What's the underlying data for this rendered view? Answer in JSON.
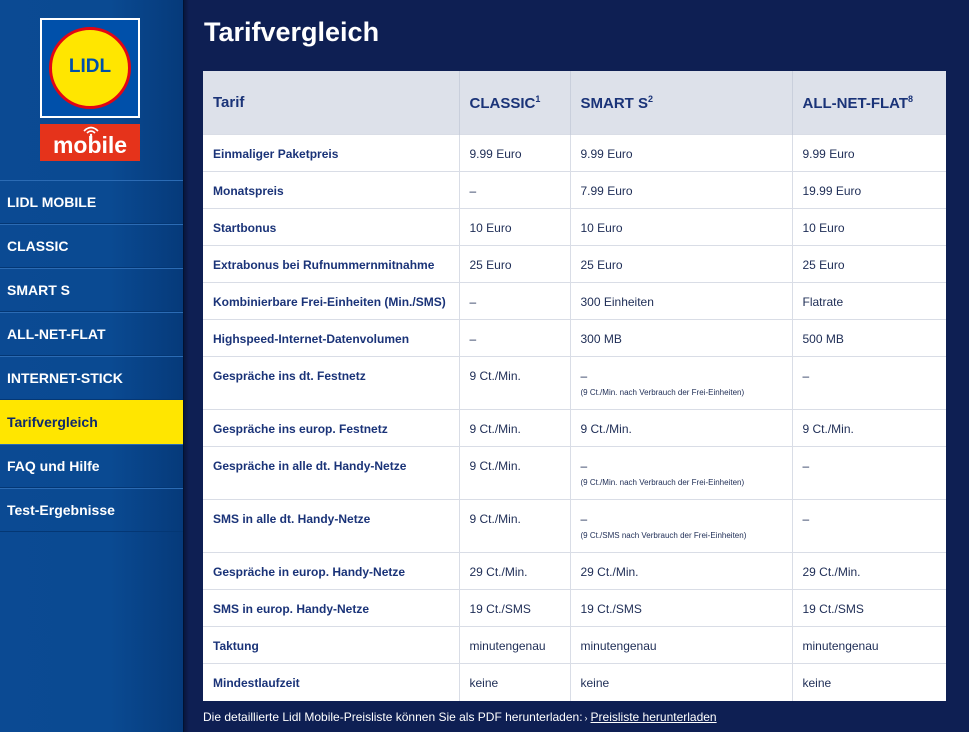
{
  "brand": {
    "logo_text": "LIDL",
    "sub": "mobile"
  },
  "nav": [
    {
      "label": "LIDL MOBILE"
    },
    {
      "label": "CLASSIC"
    },
    {
      "label": "SMART S"
    },
    {
      "label": "ALL-NET-FLAT"
    },
    {
      "label": "INTERNET-STICK"
    },
    {
      "label": "Tarifvergleich",
      "active": true
    },
    {
      "label": "FAQ und Hilfe"
    },
    {
      "label": "Test-Ergebnisse"
    }
  ],
  "page": {
    "title": "Tarifvergleich"
  },
  "table": {
    "headers": [
      {
        "label": "Tarif",
        "sup": ""
      },
      {
        "label": "CLASSIC",
        "sup": "1"
      },
      {
        "label": "SMART S",
        "sup": "2"
      },
      {
        "label": "ALL-NET-FLAT",
        "sup": "8"
      }
    ],
    "rows": [
      {
        "label": "Einmaliger Paketpreis",
        "cells": [
          {
            "v": "9.99 Euro"
          },
          {
            "v": "9.99 Euro"
          },
          {
            "v": "9.99 Euro"
          }
        ]
      },
      {
        "label": "Monatspreis",
        "cells": [
          {
            "v": "–"
          },
          {
            "v": "7.99 Euro"
          },
          {
            "v": "19.99 Euro"
          }
        ]
      },
      {
        "label": "Startbonus",
        "cells": [
          {
            "v": "10 Euro"
          },
          {
            "v": "10 Euro"
          },
          {
            "v": "10 Euro"
          }
        ]
      },
      {
        "label": "Extrabonus bei Rufnummernmitnahme",
        "cells": [
          {
            "v": "25 Euro"
          },
          {
            "v": "25 Euro"
          },
          {
            "v": "25 Euro"
          }
        ]
      },
      {
        "label": "Kombinierbare Frei-Einheiten (Min./SMS)",
        "cells": [
          {
            "v": "–"
          },
          {
            "v": "300 Einheiten"
          },
          {
            "v": "Flatrate"
          }
        ]
      },
      {
        "label": "Highspeed-Internet-Datenvolumen",
        "cells": [
          {
            "v": "–"
          },
          {
            "v": "300 MB"
          },
          {
            "v": "500 MB"
          }
        ]
      },
      {
        "label": "Gespräche ins dt. Festnetz",
        "tall": true,
        "cells": [
          {
            "v": "9 Ct./Min."
          },
          {
            "v": "–",
            "note": "(9 Ct./Min. nach Verbrauch der Frei-Einheiten)"
          },
          {
            "v": "–"
          }
        ]
      },
      {
        "label": "Gespräche ins europ. Festnetz",
        "cells": [
          {
            "v": "9 Ct./Min."
          },
          {
            "v": "9 Ct./Min."
          },
          {
            "v": "9 Ct./Min."
          }
        ]
      },
      {
        "label": "Gespräche in alle dt. Handy-Netze",
        "tall": true,
        "cells": [
          {
            "v": "9 Ct./Min."
          },
          {
            "v": "–",
            "note": "(9 Ct./Min. nach Verbrauch der Frei-Einheiten)"
          },
          {
            "v": "–"
          }
        ]
      },
      {
        "label": "SMS in alle dt. Handy-Netze",
        "tall": true,
        "cells": [
          {
            "v": "9 Ct./Min."
          },
          {
            "v": "–",
            "note": "(9 Ct./SMS nach Verbrauch der Frei-Einheiten)"
          },
          {
            "v": "–"
          }
        ]
      },
      {
        "label": "Gespräche in europ. Handy-Netze",
        "cells": [
          {
            "v": "29 Ct./Min."
          },
          {
            "v": "29 Ct./Min."
          },
          {
            "v": "29 Ct./Min."
          }
        ]
      },
      {
        "label": "SMS in europ. Handy-Netze",
        "cells": [
          {
            "v": "19 Ct./SMS"
          },
          {
            "v": "19 Ct./SMS"
          },
          {
            "v": "19 Ct./SMS"
          }
        ]
      },
      {
        "label": "Taktung",
        "cells": [
          {
            "v": "minutengenau"
          },
          {
            "v": "minutengenau"
          },
          {
            "v": "minutengenau"
          }
        ]
      },
      {
        "label": "Mindestlaufzeit",
        "cells": [
          {
            "v": "keine"
          },
          {
            "v": "keine"
          },
          {
            "v": "keine"
          }
        ]
      }
    ]
  },
  "footer": {
    "text": "Die detaillierte Lidl Mobile-Preisliste können Sie als PDF herunterladen:",
    "link": "Preisliste herunterladen"
  },
  "colors": {
    "accent_yellow": "#ffe600",
    "brand_red": "#e30613",
    "nav_blue": "#0a4a92",
    "bg_dark": "#0e1f53"
  }
}
